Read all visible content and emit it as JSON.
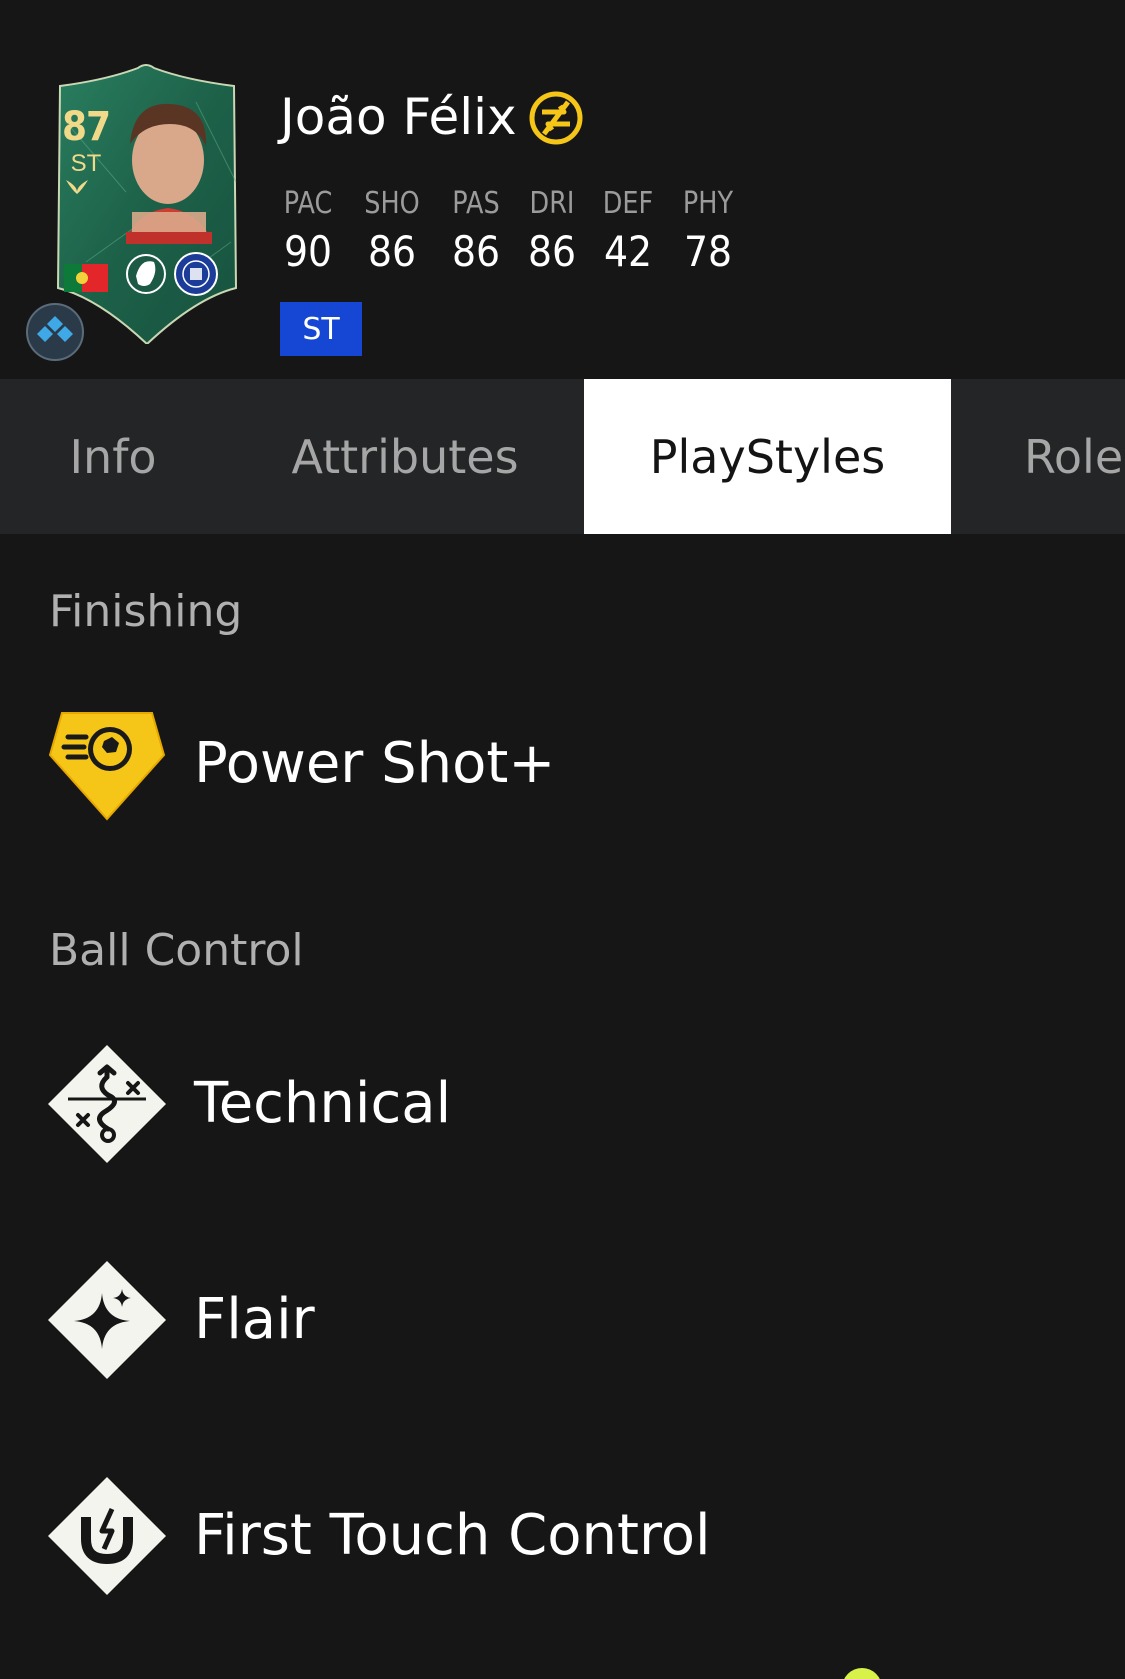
{
  "player": {
    "name": "João Félix",
    "rating": "87",
    "position": "ST",
    "position_tag": "ST",
    "icons": {
      "evolution": "evolution-swap-icon",
      "rarity": "rarity-diamond-icon",
      "nation": "portugal-flag-icon",
      "league": "premier-league-lion-icon",
      "club": "chelsea-crest-icon"
    },
    "stats": [
      {
        "label": "PAC",
        "value": "90"
      },
      {
        "label": "SHO",
        "value": "86"
      },
      {
        "label": "PAS",
        "value": "86"
      },
      {
        "label": "DRI",
        "value": "86"
      },
      {
        "label": "DEF",
        "value": "42"
      },
      {
        "label": "PHY",
        "value": "78"
      }
    ]
  },
  "tabs": [
    {
      "label": "Info",
      "active": false
    },
    {
      "label": "Attributes",
      "active": false
    },
    {
      "label": "PlayStyles",
      "active": true
    },
    {
      "label": "Roles",
      "active": false
    }
  ],
  "playstyles": {
    "sections": [
      {
        "title": "Finishing",
        "items": [
          {
            "label": "Power Shot+",
            "icon": "power-shot-plus-icon",
            "plus": true
          }
        ]
      },
      {
        "title": "Ball Control",
        "items": [
          {
            "label": "Technical",
            "icon": "technical-icon",
            "plus": false
          },
          {
            "label": "Flair",
            "icon": "flair-icon",
            "plus": false
          },
          {
            "label": "First Touch Control",
            "icon": "first-touch-control-icon",
            "plus": false
          }
        ]
      }
    ]
  },
  "colors": {
    "background": "#161617",
    "tab_bar": "#242526",
    "tab_active": "#ffffff",
    "position_tag": "#1547d4",
    "card_green": "#1f6b52",
    "gold": "#f1d98a",
    "plus_gold": "#f5c518"
  }
}
